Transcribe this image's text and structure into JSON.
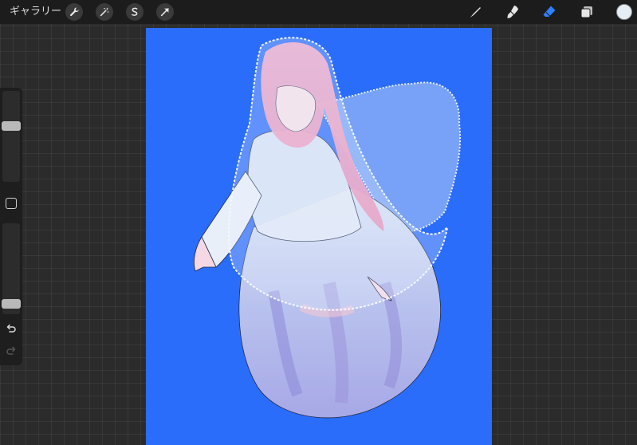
{
  "topbar": {
    "gallery_label": "ギャラリー",
    "left_tools": [
      "wrench-icon",
      "magic-wand-icon",
      "selection-icon",
      "transform-arrow-icon"
    ],
    "right_tools": [
      "brush-icon",
      "smudge-icon",
      "eraser-icon",
      "layers-icon"
    ],
    "active_tool": "eraser-icon",
    "active_color": "#e6eef5",
    "accent": "#2f80ff"
  },
  "sidebar": {
    "brush_size_level": 0.63,
    "opacity_level": 0.07
  },
  "canvas": {
    "background": "#2b6dfb"
  }
}
